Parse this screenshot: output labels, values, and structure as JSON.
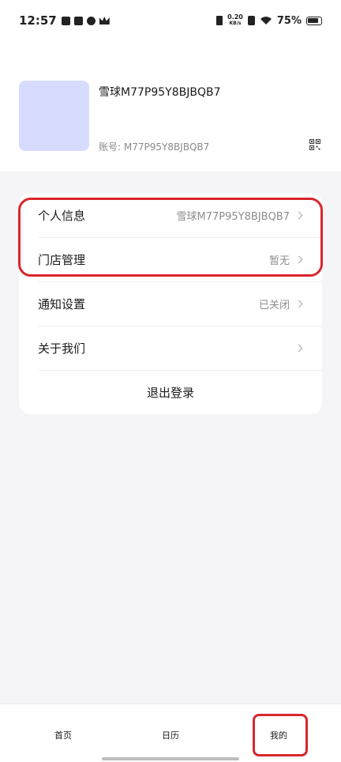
{
  "status_bar": {
    "time": "12:57",
    "net_speed_value": "0.20",
    "net_speed_unit": "KB/s",
    "battery_percent": "75%"
  },
  "profile": {
    "name": "雪球M77P95Y8BJBQB7",
    "account": "账号: M77P95Y8BJBQB7"
  },
  "menu": {
    "items": [
      {
        "label": "个人信息",
        "value": "雪球M77P95Y8BJBQB7"
      },
      {
        "label": "门店管理",
        "value": "暂无"
      },
      {
        "label": "通知设置",
        "value": "已关闭"
      },
      {
        "label": "关于我们",
        "value": ""
      }
    ],
    "logout_label": "退出登录"
  },
  "tabbar": {
    "tabs": [
      {
        "label": "首页"
      },
      {
        "label": "日历"
      },
      {
        "label": "我的"
      }
    ]
  },
  "colors": {
    "highlight": "#d9262c",
    "avatar_placeholder": "#d7dcff"
  }
}
